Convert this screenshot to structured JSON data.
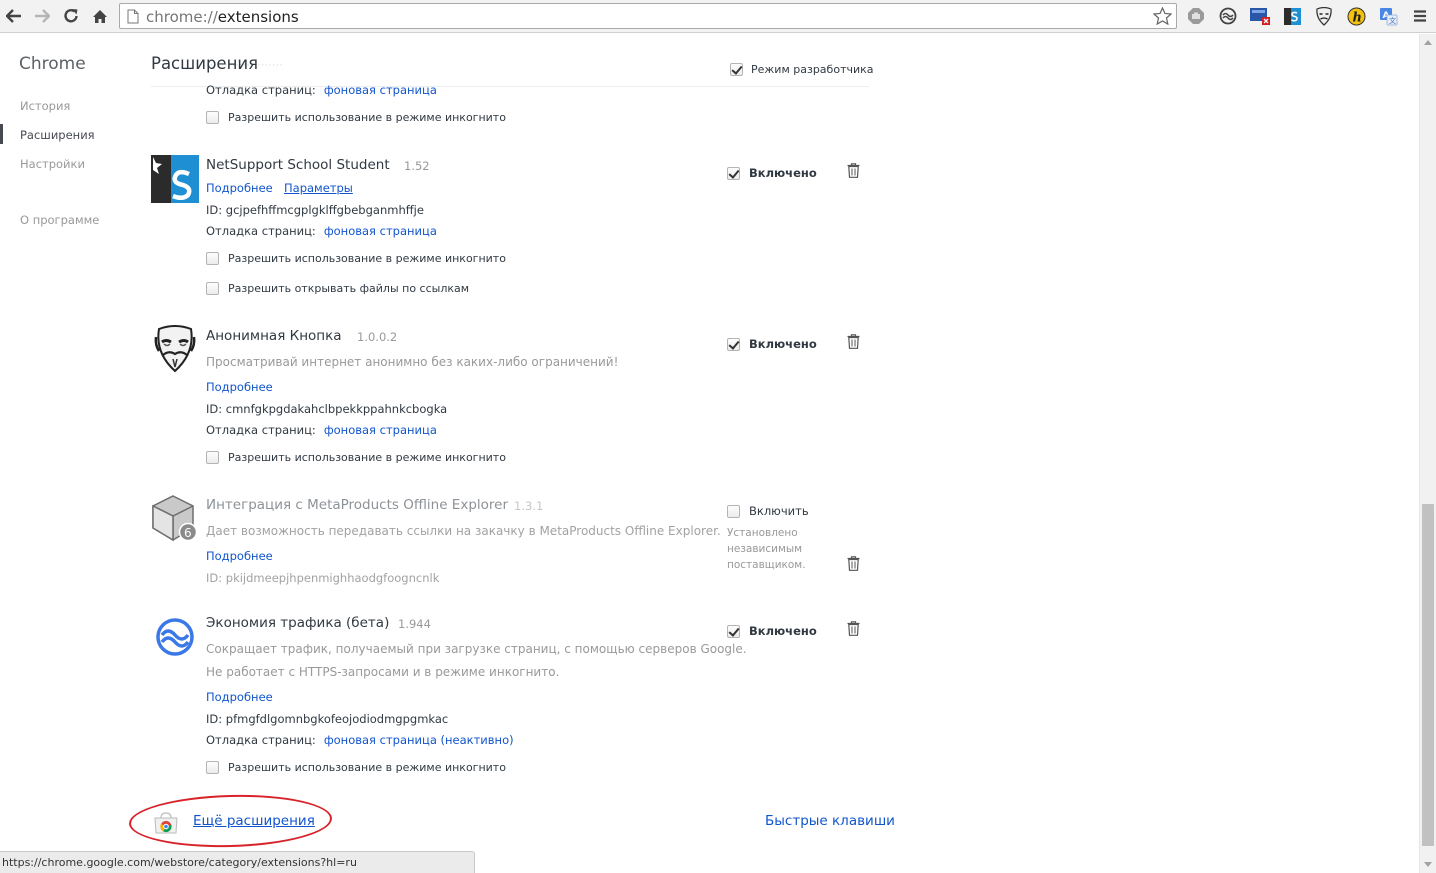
{
  "browser": {
    "url_scheme": "chrome://",
    "url_path": "extensions"
  },
  "sidebar": {
    "title": "Chrome",
    "items": [
      {
        "label": "История"
      },
      {
        "label": "Расширения"
      },
      {
        "label": "Настройки"
      },
      {
        "label": "О программе"
      }
    ]
  },
  "header": {
    "title": "Расширения",
    "dev_mode_label": "Режим разработчика",
    "dev_mode_checked": true
  },
  "top_partial": {
    "inspect_label": "Отладка страниц:",
    "inspect_link": "фоновая страница",
    "incognito_label": "Разрешить использование в режиме инкогнито"
  },
  "extensions": [
    {
      "name": "NetSupport School Student",
      "version": "1.52",
      "details_link": "Подробнее",
      "options_link": "Параметры",
      "id": "ID: gcjpefhffmcgplgklffgbebganmhffje",
      "inspect_label": "Отладка страниц:",
      "inspect_link": "фоновая страница",
      "incognito_label": "Разрешить использование в режиме инкогнито",
      "file_urls_label": "Разрешить открывать файлы по ссылкам",
      "enabled_label": "Включено",
      "enabled": true,
      "icon": "netsupport-icon"
    },
    {
      "name": "Анонимная Кнопка",
      "version": "1.0.0.2",
      "description": "Просматривай интернет анонимно без каких-либо ограничений!",
      "details_link": "Подробнее",
      "id": "ID: cmnfgkpgdakahclbpekkppahnkcbogka",
      "inspect_label": "Отладка страниц:",
      "inspect_link": "фоновая страница",
      "incognito_label": "Разрешить использование в режиме инкогнито",
      "enabled_label": "Включено",
      "enabled": true,
      "icon": "mask-icon"
    },
    {
      "name": "Интеграция с MetaProducts Offline Explorer",
      "version": "1.3.1",
      "description": "Дает возможность передавать ссылки на закачку в MetaProducts Offline Explorer.",
      "details_link": "Подробнее",
      "id": "ID: pkijdmeepjhpenmighhaodgfoogncnlk",
      "enabled_label": "Включить",
      "enabled": false,
      "policy_note": "Установлено независимым поставщиком.",
      "icon": "cube-icon"
    },
    {
      "name": "Экономия трафика (бета)",
      "version": "1.944",
      "description_line1": "Сокращает трафик, получаемый при загрузке страниц, с помощью серверов Google.",
      "description_line2": "Не работает с HTTPS-запросами и в режиме инкогнито.",
      "details_link": "Подробнее",
      "id": "ID: pfmgfdlgomnbgkofeojodiodmgpgmkac",
      "inspect_label": "Отладка страниц:",
      "inspect_link": "фоновая страница (неактивно)",
      "incognito_label": "Разрешить использование в режиме инкогнито",
      "enabled_label": "Включено",
      "enabled": true,
      "icon": "data-saver-icon"
    }
  ],
  "footer": {
    "more_extensions_link": "Ещё расширения",
    "shortcuts_link": "Быстрые клавиши"
  },
  "status_bar": {
    "text": "https://chrome.google.com/webstore/category/extensions?hl=ru"
  },
  "colors": {
    "link": "#1155cc",
    "annotation": "#d8232a",
    "text": "#303942",
    "muted": "#999999"
  }
}
